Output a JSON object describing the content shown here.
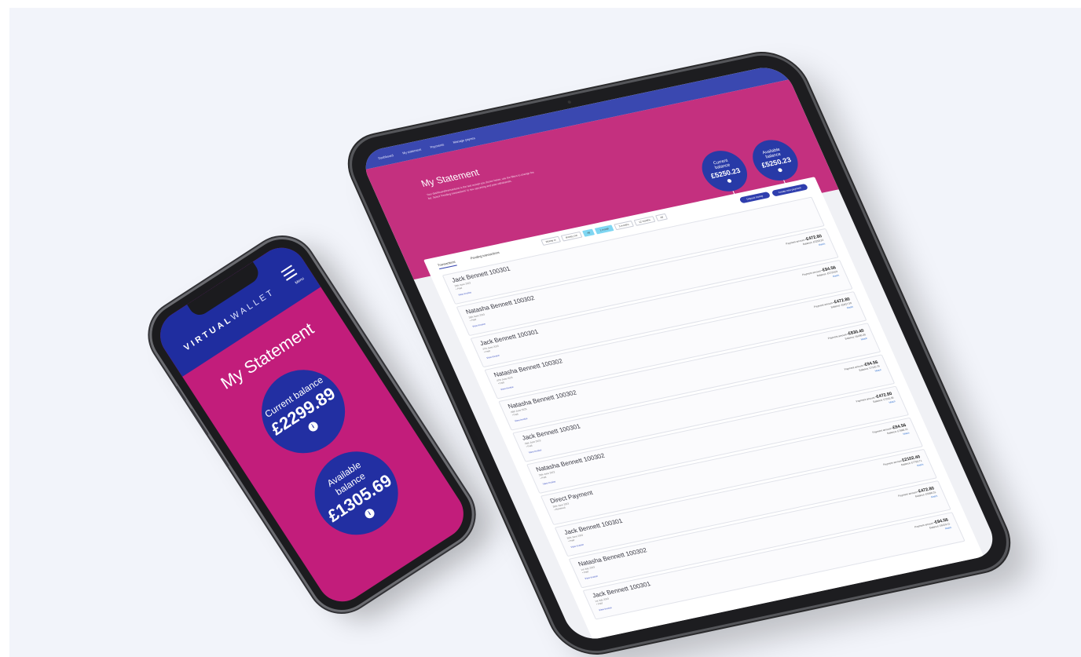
{
  "tablet": {
    "nav": [
      "Dashboard",
      "My statement",
      "Payments",
      "Manage payees"
    ],
    "title": "My Statement",
    "description": "Your dashboard/transactions is the last receipt you shown below, use the filters to change the list. Select 'Pending transactions' to see upcoming and past withdrawals.",
    "current_balance": {
      "label_line1": "Current",
      "label_line2": "balance",
      "value": "£5250.23"
    },
    "available_balance": {
      "label_line1": "Available",
      "label_line2": "balance",
      "value": "£5250.23"
    },
    "tabs": [
      "Transactions",
      "Pending transactions"
    ],
    "filters": [
      "Money in",
      "Money out",
      "All",
      "1 month",
      "3 months",
      "12 months",
      "All"
    ],
    "buttons": [
      "Deposit money",
      "Create new payment"
    ],
    "rows": [
      {
        "name": "Jack Bennett 100301",
        "date": "26th June 2023",
        "status": "• Paid",
        "view": "View invoice",
        "label": "",
        "amount": "",
        "balance": "",
        "tag": ""
      },
      {
        "name": "Natasha Bennett 100302",
        "date": "26th June 2023",
        "status": "• Paid",
        "view": "View invoice",
        "label": "Payment amount",
        "amount": "-£472.80",
        "balance": "Balance: £5250.23",
        "tag": "Match"
      },
      {
        "name": "Jack Bennett 100301",
        "date": "27th June 2023",
        "status": "• Paid",
        "view": "View invoice",
        "label": "Payment amount",
        "amount": "-£94.56",
        "balance": "Balance: £5723.03",
        "tag": "Match"
      },
      {
        "name": "Natasha Bennett 100302",
        "date": "27th June 2023",
        "status": "• Paid",
        "view": "View invoice",
        "label": "Payment amount",
        "amount": "-£472.80",
        "balance": "Balance: £5817.59",
        "tag": "Match"
      },
      {
        "name": "Natasha Bennett 100302",
        "date": "28th June 2023",
        "status": "• Paid",
        "view": "View invoice",
        "label": "Payment amount",
        "amount": "-£830.40",
        "balance": "Balance: £6290.39",
        "tag": "Match"
      },
      {
        "name": "Jack Bennett 100301",
        "date": "29th June 2023",
        "status": "• Paid",
        "view": "View invoice",
        "label": "Payment amount",
        "amount": "-£94.56",
        "balance": "Balance: £7120.79",
        "tag": "Match"
      },
      {
        "name": "Natasha Bennett 100302",
        "date": "29th June 2023",
        "status": "• Paid",
        "view": "View invoice",
        "label": "Payment amount",
        "amount": "-£472.80",
        "balance": "Balance: £7215.35",
        "tag": "Match"
      },
      {
        "name": "Direct Payment",
        "date": "30th June 2023",
        "status": "• Received",
        "view": "",
        "label": "Payment amount",
        "amount": "-£94.56",
        "balance": "Balance: £7688.15",
        "tag": "Match"
      },
      {
        "name": "Jack Bennett 100301",
        "date": "30th June 2023",
        "status": "• Paid",
        "view": "View invoice",
        "label": "Payment amount",
        "amount": "£2102.40",
        "balance": "Balance: £7782.71",
        "tag": "Match"
      },
      {
        "name": "Natasha Bennett 100302",
        "date": "1st July 2023",
        "status": "• Paid",
        "view": "View invoice",
        "label": "Payment amount",
        "amount": "-£472.80",
        "balance": "Balance: £5680.31",
        "tag": "Match"
      },
      {
        "name": "Jack Bennett 100301",
        "date": "1st July 2023",
        "status": "• Paid",
        "view": "View invoice",
        "label": "Payment amount",
        "amount": "-£94.56",
        "balance": "Balance: £6153.11",
        "tag": "Match"
      }
    ]
  },
  "phone": {
    "logo_bold": "VIRTUAL",
    "logo_light": "WALLET",
    "menu_label": "Menu",
    "title": "My Statement",
    "current_balance": {
      "label": "Current balance",
      "value": "£2299.89"
    },
    "available_balance": {
      "label_line1": "Available",
      "label_line2": "balance",
      "value": "£1305.69"
    },
    "info_glyph": "i"
  }
}
